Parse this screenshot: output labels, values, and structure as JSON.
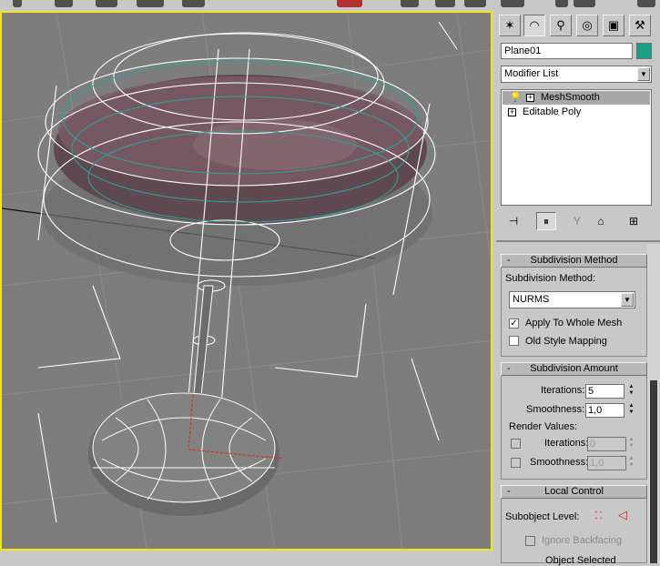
{
  "command_panel": {
    "tabs": [
      {
        "icon": "create-icon",
        "glyph": "✶"
      },
      {
        "icon": "modify-icon",
        "glyph": "◠"
      },
      {
        "icon": "hierarchy-icon",
        "glyph": "⚲"
      },
      {
        "icon": "motion-icon",
        "glyph": "◎"
      },
      {
        "icon": "display-icon",
        "glyph": "▣"
      },
      {
        "icon": "utilities-icon",
        "glyph": "⚒"
      }
    ],
    "object_name": "Plane01",
    "object_color": "#1aa083",
    "modifier_list_label": "Modifier List",
    "stack": [
      {
        "label": "MeshSmooth",
        "selected": true
      },
      {
        "label": "Editable Poly",
        "selected": false
      }
    ]
  },
  "subdivision_method": {
    "title": "Subdivision Method",
    "method_label": "Subdivision Method:",
    "method_value": "NURMS",
    "apply_whole_mesh_label": "Apply To Whole Mesh",
    "apply_whole_mesh_checked": true,
    "old_style_label": "Old Style Mapping",
    "old_style_checked": false
  },
  "subdivision_amount": {
    "title": "Subdivision Amount",
    "iterations_label": "Iterations:",
    "iterations_value": "5",
    "smoothness_label": "Smoothness:",
    "smoothness_value": "1,0",
    "render_values_label": "Render Values:",
    "render_iterations_label": "Iterations:",
    "render_iterations_value": "0",
    "render_smoothness_label": "Smoothness:",
    "render_smoothness_value": "1,0"
  },
  "local_control": {
    "title": "Local Control",
    "subobject_label": "Subobject Level:",
    "ignore_backfacing_label": "Ignore Backfacing",
    "object_selected_label": "Object Selected"
  },
  "colors": {
    "viewport_border": "#f5e41a",
    "viewport_bg": "#7d7d7d",
    "selection_highlight": "#a8a8a8"
  }
}
